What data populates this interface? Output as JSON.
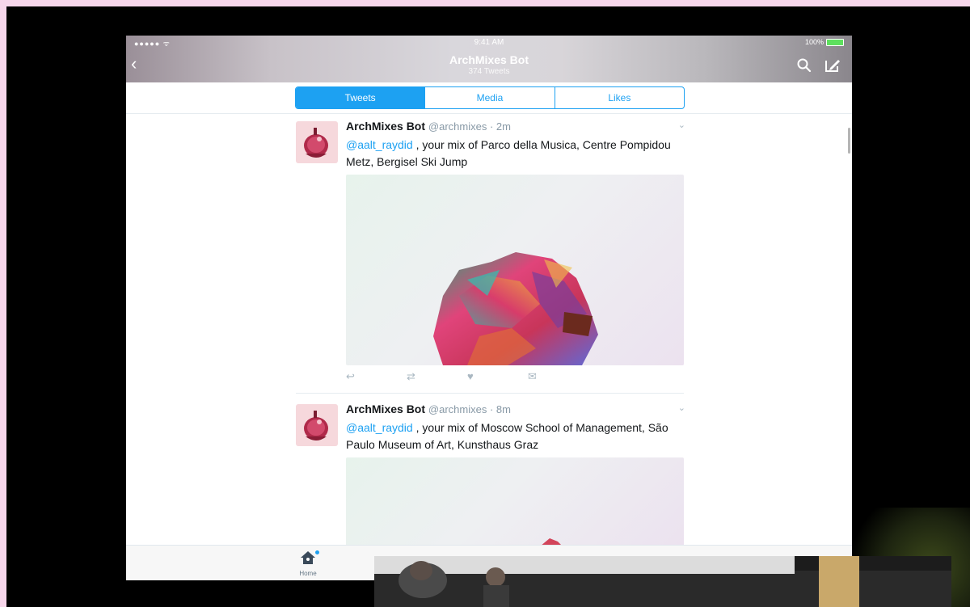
{
  "status_bar": {
    "signal": "●●●●● ᯤ",
    "time": "9:41 AM",
    "battery": "100%"
  },
  "navbar": {
    "title": "ArchMixes Bot",
    "subtitle": "374 Tweets"
  },
  "tabs": [
    {
      "label": "Tweets",
      "active": true
    },
    {
      "label": "Media",
      "active": false
    },
    {
      "label": "Likes",
      "active": false
    }
  ],
  "tweets": [
    {
      "name": "ArchMixes Bot",
      "meta": "@archmixes · 2m",
      "mention": "@aalt_raydid",
      "text": " , your mix of Parco della Musica, Centre Pompidou Metz, Bergisel Ski Jump"
    },
    {
      "name": "ArchMixes Bot",
      "meta": "@archmixes · 8m",
      "mention": "@aalt_raydid",
      "text": " , your mix of Moscow School of Management, São Paulo Museum of Art, Kunsthaus Graz"
    }
  ],
  "tab_bar": {
    "home_label": "Home"
  },
  "colors": {
    "accent": "#1da1f2",
    "text": "#14171a",
    "muted": "#8899a6"
  }
}
